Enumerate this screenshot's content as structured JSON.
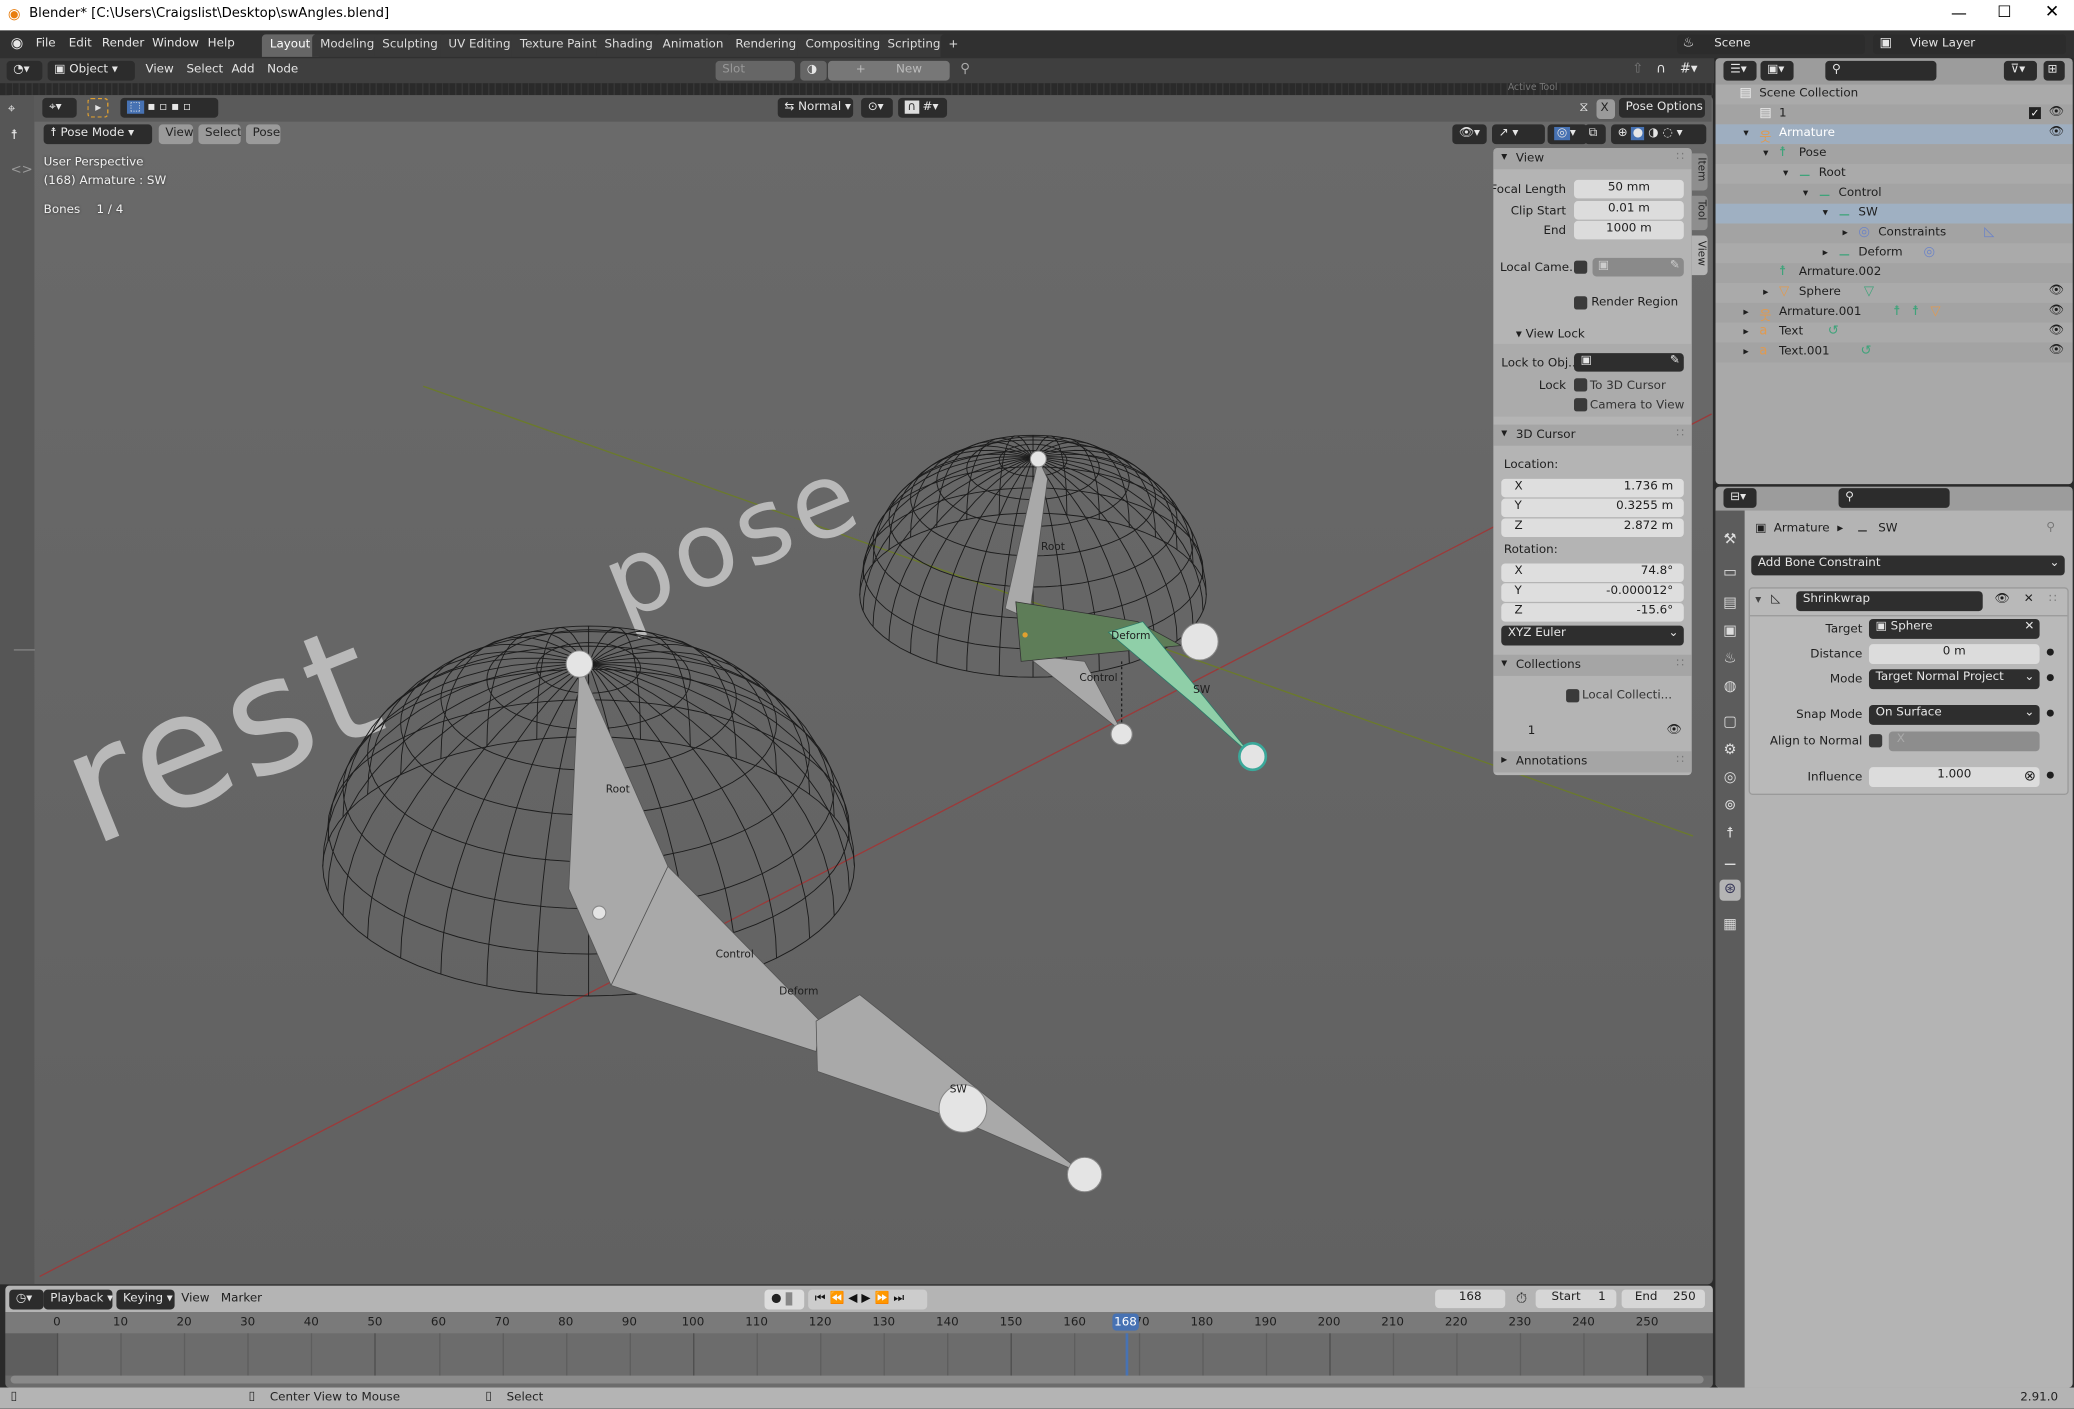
{
  "window": {
    "title": "Blender* [C:\\Users\\Craigslist\\Desktop\\swAngles.blend]",
    "controls": [
      "minimize-icon",
      "maximize-icon",
      "close-icon"
    ]
  },
  "menu": {
    "items": [
      "File",
      "Edit",
      "Render",
      "Window",
      "Help"
    ],
    "workspaces": [
      "Layout",
      "Modeling",
      "Sculpting",
      "UV Editing",
      "Texture Paint",
      "Shading",
      "Animation",
      "Rendering",
      "Compositing",
      "Scripting"
    ],
    "active_workspace": "Layout",
    "add_tab": "+",
    "scene": "Scene",
    "view_layer": "View Layer"
  },
  "node_header": {
    "mode": "Object",
    "items": [
      "View",
      "Select",
      "Add",
      "Node"
    ],
    "slot": "Slot",
    "new_label": "New",
    "new_plus": "+"
  },
  "hidden_panel_hint": "Active Tool",
  "viewport": {
    "orientation": "Normal",
    "pose_options": "Pose Options",
    "x_mirror": "X",
    "mode": "Pose Mode",
    "menus": [
      "View",
      "Select",
      "Pose"
    ],
    "overlay": {
      "perspective": "User Perspective",
      "object": "(168) Armature : SW",
      "bones_label": "Bones",
      "bones_value": "1 / 4"
    },
    "scene_text": {
      "rest": "rest",
      "pose": "pose"
    },
    "bone_labels": {
      "root_rest": "Root",
      "control_rest": "Control",
      "deform_rest": "Deform",
      "sw_rest": "SW",
      "root_pose": "Root",
      "control_pose": "Control",
      "deform_pose": "Deform",
      "sw_pose": "SW"
    },
    "colors": {
      "x_axis": "#9b3a3a",
      "y_axis": "#6b7a2c",
      "selected_bone": "#8fcfa8",
      "active_bone_group": "#5e7d58",
      "bone": "#a9a9a9"
    }
  },
  "npanel": {
    "tabs": [
      "Item",
      "Tool",
      "View"
    ],
    "active_tab": "View",
    "view": {
      "title": "View",
      "focal_length_label": "Focal Length",
      "focal_length": "50 mm",
      "clip_start_label": "Clip Start",
      "clip_start": "0.01 m",
      "end_label": "End",
      "end": "1000 m",
      "local_camera_label": "Local Came...",
      "render_region": "Render Region",
      "view_lock_title": "View Lock",
      "lock_to_obj_label": "Lock to Obj...",
      "lock_label": "Lock",
      "to_3d_cursor": "To 3D Cursor",
      "camera_to_view": "Camera to View"
    },
    "cursor": {
      "title": "3D Cursor",
      "location_label": "Location:",
      "loc": [
        {
          "axis": "X",
          "value": "1.736 m"
        },
        {
          "axis": "Y",
          "value": "0.3255 m"
        },
        {
          "axis": "Z",
          "value": "2.872 m"
        }
      ],
      "rotation_label": "Rotation:",
      "rot": [
        {
          "axis": "X",
          "value": "74.8°"
        },
        {
          "axis": "Y",
          "value": "-0.000012°"
        },
        {
          "axis": "Z",
          "value": "-15.6°"
        }
      ],
      "rotation_mode": "XYZ Euler"
    },
    "collections": {
      "title": "Collections",
      "local_collections": "Local Collecti...",
      "item": "1"
    },
    "annotations": {
      "title": "Annotations"
    }
  },
  "outliner": {
    "rows": [
      {
        "label": "Scene Collection",
        "level": 0,
        "icon": "collection-icon"
      },
      {
        "label": "1",
        "level": 1,
        "icon": "collection-icon",
        "checkbox": true,
        "visible": true
      },
      {
        "label": "Armature",
        "level": 1,
        "icon": "armature-icon",
        "expanded": true,
        "visible": true,
        "selected": true
      },
      {
        "label": "Pose",
        "level": 2,
        "icon": "pose-icon",
        "expanded": true
      },
      {
        "label": "Root",
        "level": 3,
        "icon": "bone-icon",
        "expanded": true
      },
      {
        "label": "Control",
        "level": 4,
        "icon": "bone-icon",
        "expanded": true
      },
      {
        "label": "SW",
        "level": 5,
        "icon": "bone-icon",
        "expanded": true,
        "active": true
      },
      {
        "label": "Constraints",
        "level": 6,
        "icon": "constraint-icon",
        "collapsed": true,
        "extra": [
          "shrinkwrap-icon"
        ]
      },
      {
        "label": "Deform",
        "level": 5,
        "icon": "bone-icon",
        "collapsed": true,
        "extra": [
          "constraint-icon"
        ]
      },
      {
        "label": "Armature.002",
        "level": 2,
        "icon": "armature-data-icon"
      },
      {
        "label": "Sphere",
        "level": 2,
        "icon": "mesh-icon",
        "collapsed": true,
        "visible": true,
        "extra": [
          "mesh-data-icon"
        ]
      },
      {
        "label": "Armature.001",
        "level": 1,
        "icon": "armature-icon",
        "collapsed": true,
        "visible": true,
        "extra": [
          "armature-data-icon",
          "pose-icon",
          "mesh-icon"
        ]
      },
      {
        "label": "Text",
        "level": 1,
        "icon": "text-icon",
        "collapsed": true,
        "visible": true,
        "extra": [
          "curve-icon"
        ]
      },
      {
        "label": "Text.001",
        "level": 1,
        "icon": "text-icon",
        "collapsed": true,
        "visible": true,
        "extra": [
          "curve-icon"
        ]
      }
    ]
  },
  "properties": {
    "tabs": [
      "tool-icon",
      "render-icon",
      "output-icon",
      "view-layer-icon",
      "scene-icon",
      "world-icon",
      "object-icon",
      "modifier-icon",
      "physics-icon",
      "object-constraint-icon",
      "armature-data-icon",
      "bone-icon",
      "bone-constraint-icon",
      "texture-icon"
    ],
    "active_tab": "bone-constraint-icon",
    "breadcrumb": [
      "Armature",
      "SW"
    ],
    "add_constraint": "Add Bone Constraint",
    "constraint": {
      "name": "Shrinkwrap",
      "target_label": "Target",
      "target": "Sphere",
      "distance_label": "Distance",
      "distance": "0 m",
      "mode_label": "Mode",
      "mode": "Target Normal Project",
      "snap_mode_label": "Snap Mode",
      "snap_mode": "On Surface",
      "align_label": "Align to Normal",
      "align_axis": "X",
      "influence_label": "Influence",
      "influence": "1.000"
    }
  },
  "timeline": {
    "playback": "Playback",
    "keying": "Keying",
    "view": "View",
    "marker": "Marker",
    "current_frame": "168",
    "start_label": "Start",
    "start": "1",
    "end_label": "End",
    "end": "250",
    "ticks": [
      "0",
      "10",
      "20",
      "30",
      "40",
      "50",
      "60",
      "70",
      "80",
      "90",
      "100",
      "110",
      "120",
      "130",
      "140",
      "150",
      "160",
      "170",
      "180",
      "190",
      "200",
      "210",
      "220",
      "230",
      "240",
      "250"
    ],
    "playhead": "168",
    "accent": "#4772b3"
  },
  "status": {
    "middle_mouse": "Center View to Mouse",
    "left_mouse": "Select",
    "version": "2.91.0"
  }
}
